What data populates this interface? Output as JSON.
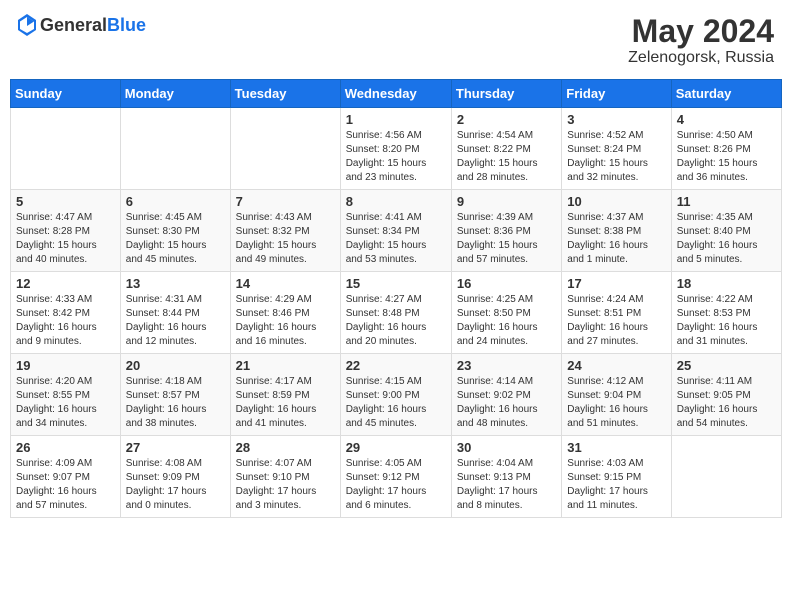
{
  "header": {
    "logo_general": "General",
    "logo_blue": "Blue",
    "month_year": "May 2024",
    "location": "Zelenogorsk, Russia"
  },
  "days_of_week": [
    "Sunday",
    "Monday",
    "Tuesday",
    "Wednesday",
    "Thursday",
    "Friday",
    "Saturday"
  ],
  "weeks": [
    [
      {
        "day": "",
        "info": ""
      },
      {
        "day": "",
        "info": ""
      },
      {
        "day": "",
        "info": ""
      },
      {
        "day": "1",
        "info": "Sunrise: 4:56 AM\nSunset: 8:20 PM\nDaylight: 15 hours\nand 23 minutes."
      },
      {
        "day": "2",
        "info": "Sunrise: 4:54 AM\nSunset: 8:22 PM\nDaylight: 15 hours\nand 28 minutes."
      },
      {
        "day": "3",
        "info": "Sunrise: 4:52 AM\nSunset: 8:24 PM\nDaylight: 15 hours\nand 32 minutes."
      },
      {
        "day": "4",
        "info": "Sunrise: 4:50 AM\nSunset: 8:26 PM\nDaylight: 15 hours\nand 36 minutes."
      }
    ],
    [
      {
        "day": "5",
        "info": "Sunrise: 4:47 AM\nSunset: 8:28 PM\nDaylight: 15 hours\nand 40 minutes."
      },
      {
        "day": "6",
        "info": "Sunrise: 4:45 AM\nSunset: 8:30 PM\nDaylight: 15 hours\nand 45 minutes."
      },
      {
        "day": "7",
        "info": "Sunrise: 4:43 AM\nSunset: 8:32 PM\nDaylight: 15 hours\nand 49 minutes."
      },
      {
        "day": "8",
        "info": "Sunrise: 4:41 AM\nSunset: 8:34 PM\nDaylight: 15 hours\nand 53 minutes."
      },
      {
        "day": "9",
        "info": "Sunrise: 4:39 AM\nSunset: 8:36 PM\nDaylight: 15 hours\nand 57 minutes."
      },
      {
        "day": "10",
        "info": "Sunrise: 4:37 AM\nSunset: 8:38 PM\nDaylight: 16 hours\nand 1 minute."
      },
      {
        "day": "11",
        "info": "Sunrise: 4:35 AM\nSunset: 8:40 PM\nDaylight: 16 hours\nand 5 minutes."
      }
    ],
    [
      {
        "day": "12",
        "info": "Sunrise: 4:33 AM\nSunset: 8:42 PM\nDaylight: 16 hours\nand 9 minutes."
      },
      {
        "day": "13",
        "info": "Sunrise: 4:31 AM\nSunset: 8:44 PM\nDaylight: 16 hours\nand 12 minutes."
      },
      {
        "day": "14",
        "info": "Sunrise: 4:29 AM\nSunset: 8:46 PM\nDaylight: 16 hours\nand 16 minutes."
      },
      {
        "day": "15",
        "info": "Sunrise: 4:27 AM\nSunset: 8:48 PM\nDaylight: 16 hours\nand 20 minutes."
      },
      {
        "day": "16",
        "info": "Sunrise: 4:25 AM\nSunset: 8:50 PM\nDaylight: 16 hours\nand 24 minutes."
      },
      {
        "day": "17",
        "info": "Sunrise: 4:24 AM\nSunset: 8:51 PM\nDaylight: 16 hours\nand 27 minutes."
      },
      {
        "day": "18",
        "info": "Sunrise: 4:22 AM\nSunset: 8:53 PM\nDaylight: 16 hours\nand 31 minutes."
      }
    ],
    [
      {
        "day": "19",
        "info": "Sunrise: 4:20 AM\nSunset: 8:55 PM\nDaylight: 16 hours\nand 34 minutes."
      },
      {
        "day": "20",
        "info": "Sunrise: 4:18 AM\nSunset: 8:57 PM\nDaylight: 16 hours\nand 38 minutes."
      },
      {
        "day": "21",
        "info": "Sunrise: 4:17 AM\nSunset: 8:59 PM\nDaylight: 16 hours\nand 41 minutes."
      },
      {
        "day": "22",
        "info": "Sunrise: 4:15 AM\nSunset: 9:00 PM\nDaylight: 16 hours\nand 45 minutes."
      },
      {
        "day": "23",
        "info": "Sunrise: 4:14 AM\nSunset: 9:02 PM\nDaylight: 16 hours\nand 48 minutes."
      },
      {
        "day": "24",
        "info": "Sunrise: 4:12 AM\nSunset: 9:04 PM\nDaylight: 16 hours\nand 51 minutes."
      },
      {
        "day": "25",
        "info": "Sunrise: 4:11 AM\nSunset: 9:05 PM\nDaylight: 16 hours\nand 54 minutes."
      }
    ],
    [
      {
        "day": "26",
        "info": "Sunrise: 4:09 AM\nSunset: 9:07 PM\nDaylight: 16 hours\nand 57 minutes."
      },
      {
        "day": "27",
        "info": "Sunrise: 4:08 AM\nSunset: 9:09 PM\nDaylight: 17 hours\nand 0 minutes."
      },
      {
        "day": "28",
        "info": "Sunrise: 4:07 AM\nSunset: 9:10 PM\nDaylight: 17 hours\nand 3 minutes."
      },
      {
        "day": "29",
        "info": "Sunrise: 4:05 AM\nSunset: 9:12 PM\nDaylight: 17 hours\nand 6 minutes."
      },
      {
        "day": "30",
        "info": "Sunrise: 4:04 AM\nSunset: 9:13 PM\nDaylight: 17 hours\nand 8 minutes."
      },
      {
        "day": "31",
        "info": "Sunrise: 4:03 AM\nSunset: 9:15 PM\nDaylight: 17 hours\nand 11 minutes."
      },
      {
        "day": "",
        "info": ""
      }
    ]
  ]
}
